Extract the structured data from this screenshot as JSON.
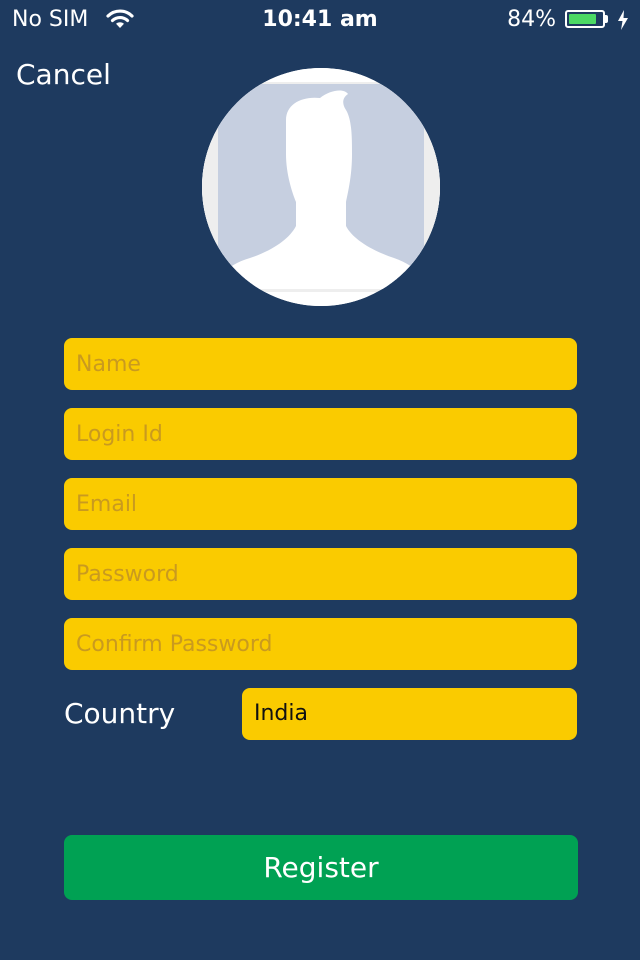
{
  "status_bar": {
    "carrier": "No SIM",
    "time": "10:41 am",
    "battery_percent": "84%",
    "battery_level": 0.84,
    "wifi_icon": "wifi-icon",
    "charging_icon": "lightning-bolt-icon"
  },
  "header": {
    "cancel_label": "Cancel"
  },
  "avatar": {
    "icon": "default-profile-silhouette-icon"
  },
  "form": {
    "name_placeholder": "Name",
    "login_placeholder": "Login Id",
    "email_placeholder": "Email",
    "password_placeholder": "Password",
    "confirm_password_placeholder": "Confirm Password",
    "country_label": "Country",
    "country_value": "India"
  },
  "actions": {
    "register_label": "Register"
  },
  "colors": {
    "background": "#1e3a5f",
    "field": "#facb00",
    "placeholder": "#c99a1f",
    "register": "#00a153",
    "battery": "#4cd964"
  }
}
